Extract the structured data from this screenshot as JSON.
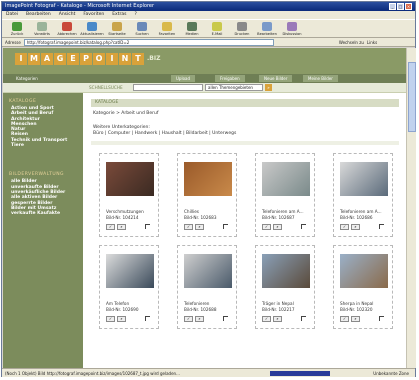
{
  "window": {
    "title": "ImagePoint Fotograf - Kataloge - Microsoft Internet Explorer"
  },
  "menu": [
    "Datei",
    "Bearbeiten",
    "Ansicht",
    "Favoriten",
    "Extras",
    "?"
  ],
  "toolbar": [
    "Zurück",
    "Vorwärts",
    "Abbrechen",
    "Aktualisieren",
    "Startseite",
    "Suchen",
    "Favoriten",
    "Medien",
    "E-Mail",
    "Drucken",
    "Bearbeiten",
    "Diskussion"
  ],
  "address": {
    "label": "Adresse",
    "url": "http://fotograf.imagepoint.biz/katalog.php?catID=2",
    "go": "Wechseln zu",
    "links": "Links"
  },
  "site": {
    "logo_letters": [
      "I",
      "M",
      "A",
      "G",
      "E",
      "P",
      "O",
      "I",
      "N",
      "T"
    ],
    "logo_suffix": ".BIZ",
    "nav_top_left": "Kategorien",
    "nav_tabs": [
      "Upload",
      "Freigaben",
      "Neue Bilder",
      "Meine Bilder"
    ],
    "search_label": "SCHNELLSUCHE",
    "search_select": "allen Themengebieten",
    "sidebar_head1": "KATALOGE",
    "categories": [
      "Action und Sport",
      "Arbeit und Beruf",
      "Architektur",
      "Menschen",
      "Natur",
      "Reisen",
      "Technik und Transport",
      "Tiere"
    ],
    "sidebar_head2": "BILDERVERWALTUNG",
    "manage": [
      "alle Bilder",
      "unverkaufte Bilder",
      "unverkäufliche Bilder",
      "alle aktiven Bilder",
      "gesperrte Bilder",
      "Bilder mit Umsatz",
      "verkaufte Kaufakte"
    ],
    "catbar": "KATALOGE",
    "breadcrumb": "Kategorie > Arbeit und Beruf",
    "subcats_label": "Weitere Unterkategorien:",
    "subcats": "Büro | Computer | Handwerk | Haushalt | Bildarbeit | Unterwegs"
  },
  "cards": [
    {
      "title": "Verschmutzungen",
      "id": "Bild-Nr. 104214",
      "c1": "#7a4a3a",
      "c2": "#3a2a22"
    },
    {
      "title": "Chillies",
      "id": "Bild-Nr. 102683",
      "c1": "#9a5a2a",
      "c2": "#c98a4a"
    },
    {
      "title": "Telefonieren am A...",
      "id": "Bild-Nr. 102687",
      "c1": "#c9c9c9",
      "c2": "#7a8a8a"
    },
    {
      "title": "Telefonieren am A...",
      "id": "Bild-Nr. 102686",
      "c1": "#d9d9d9",
      "c2": "#5a6a7a"
    },
    {
      "title": "Am Telefon",
      "id": "Bild-Nr. 102690",
      "c1": "#dcdcdc",
      "c2": "#3a4a5a"
    },
    {
      "title": "Telefonieren",
      "id": "Bild-Nr. 102688",
      "c1": "#cfcfcf",
      "c2": "#4a5a6a"
    },
    {
      "title": "Träger in Nepal",
      "id": "Bild-Nr. 102217",
      "c1": "#8aa0b8",
      "c2": "#5a4a3a"
    },
    {
      "title": "Sherpa in Nepal",
      "id": "Bild-Nr. 102320",
      "c1": "#9ab0c8",
      "c2": "#8a6a4a"
    }
  ],
  "status": {
    "text": "(Noch 1 Objekt) Bild http://fotograf.imagepoint.biz/images/102687_t.jpg wird geladen...",
    "zone": "Unbekannte Zone"
  },
  "colors": {
    "olive": "#8a9a66",
    "sidebar": "#7c8c5c",
    "accent": "#d9a23a"
  }
}
